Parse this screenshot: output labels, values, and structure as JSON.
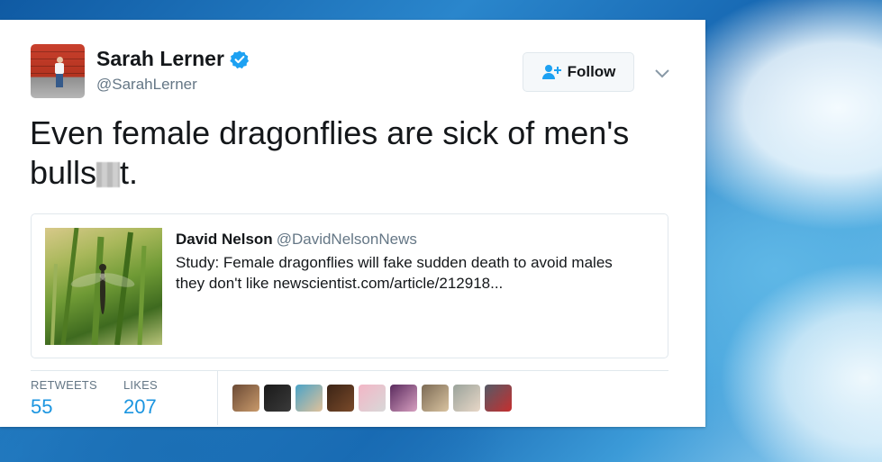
{
  "user": {
    "name": "Sarah Lerner",
    "handle": "@SarahLerner",
    "verified": true
  },
  "follow_button": {
    "label": "Follow"
  },
  "tweet": {
    "text_before": "Even female dragonflies are sick of men's bulls",
    "text_after": "t."
  },
  "quoted_tweet": {
    "author_name": "David Nelson",
    "author_handle": "@DavidNelsonNews",
    "text": "Study:  Female dragonflies will fake sudden death to avoid males they don't like  newscientist.com/article/212918..."
  },
  "stats": {
    "retweets_label": "RETWEETS",
    "retweets_count": "55",
    "likes_label": "LIKES",
    "likes_count": "207"
  },
  "colors": {
    "accent": "#1b95e0",
    "verified": "#1da1f2",
    "text": "#14171a",
    "muted": "#657786",
    "border": "#e1e8ed"
  },
  "likers": [
    {
      "colors": [
        "#6b4a35",
        "#c99a6b"
      ]
    },
    {
      "colors": [
        "#1a1a1a",
        "#3a3a3a"
      ]
    },
    {
      "colors": [
        "#4aa3c7",
        "#e0c19a"
      ]
    },
    {
      "colors": [
        "#3b2416",
        "#7a4a2a"
      ]
    },
    {
      "colors": [
        "#f3b6c6",
        "#d8d8d8"
      ]
    },
    {
      "colors": [
        "#5a2a5e",
        "#d7a0c0"
      ]
    },
    {
      "colors": [
        "#7c6b55",
        "#d9c3a0"
      ]
    },
    {
      "colors": [
        "#9aa39b",
        "#e8d7c7"
      ]
    },
    {
      "colors": [
        "#555a66",
        "#c62f2f"
      ]
    }
  ]
}
